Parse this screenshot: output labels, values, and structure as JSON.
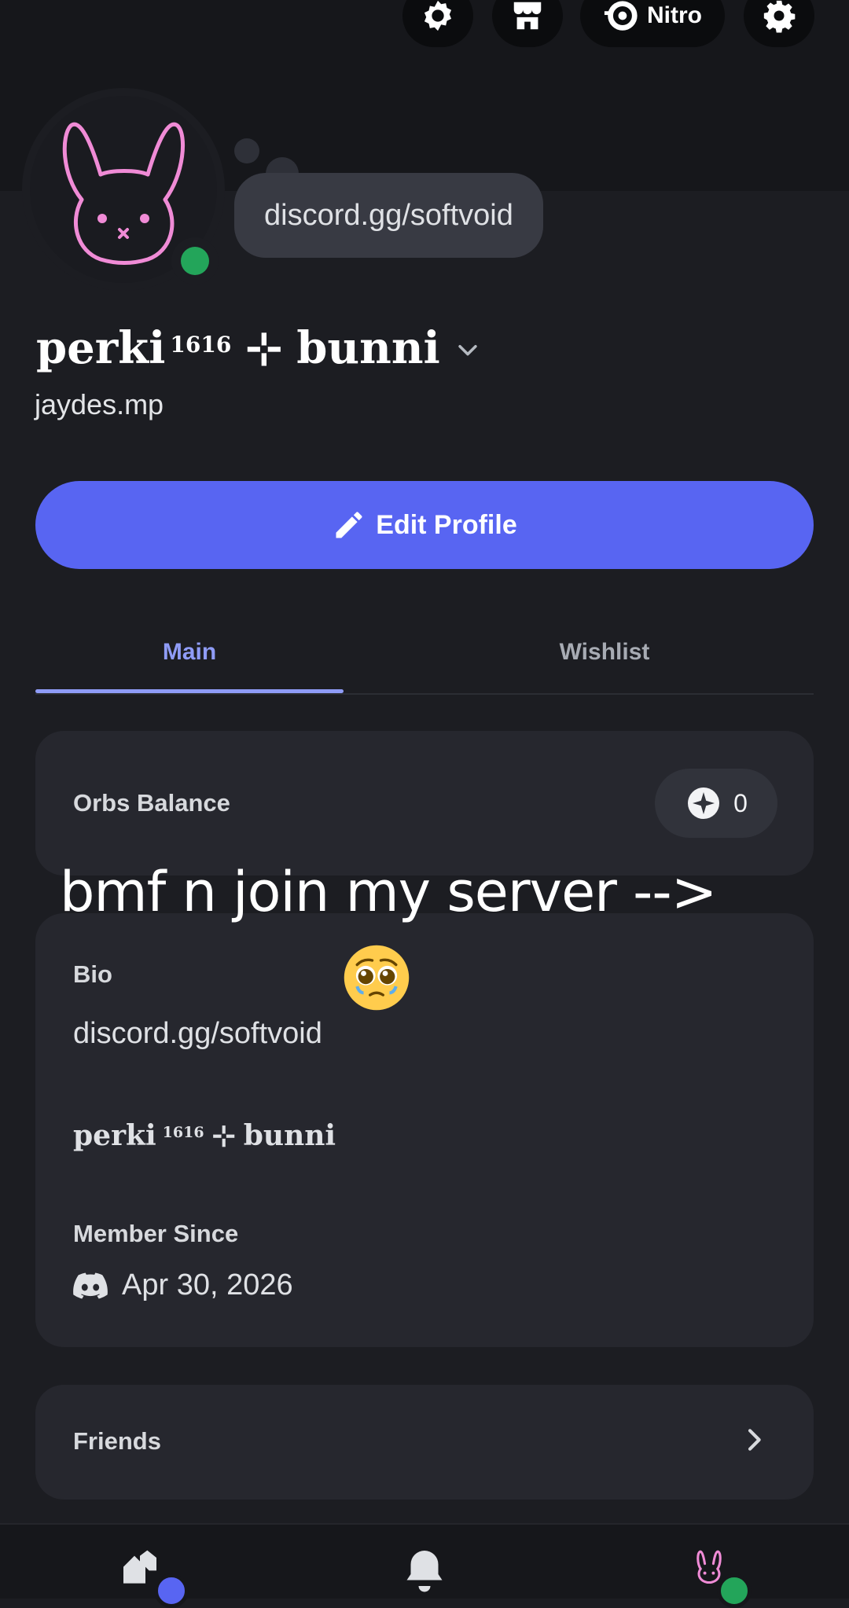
{
  "topbar": {
    "nitro_label": "Nitro"
  },
  "profile": {
    "status_bubble": "discord.gg/softvoid",
    "display_name": {
      "first": "perki",
      "superscript": "1616",
      "separator": "⊹",
      "last": "bunni"
    },
    "username": "jaydes.mp",
    "edit_button_label": "Edit Profile"
  },
  "tabs": [
    {
      "label": "Main",
      "active": true
    },
    {
      "label": "Wishlist",
      "active": false
    }
  ],
  "orbs": {
    "label": "Orbs Balance",
    "value": "0"
  },
  "overlay_caption": "bmf n join my server -->",
  "bio": {
    "title": "Bio",
    "emoji": "pleading-face-emoji",
    "text": "discord.gg/softvoid",
    "name": {
      "first": "perki",
      "superscript": "1616",
      "separator": "⊹",
      "last": "bunni"
    },
    "member_since_title": "Member Since",
    "member_since_date": "Apr 30, 2026"
  },
  "friends": {
    "label": "Friends"
  },
  "colors": {
    "accent": "#5865f2",
    "tab_active": "#8f9cf7",
    "online": "#23a55a",
    "avatar_pink": "#f08bd6",
    "background": "#1c1d22",
    "card": "#26272e"
  }
}
